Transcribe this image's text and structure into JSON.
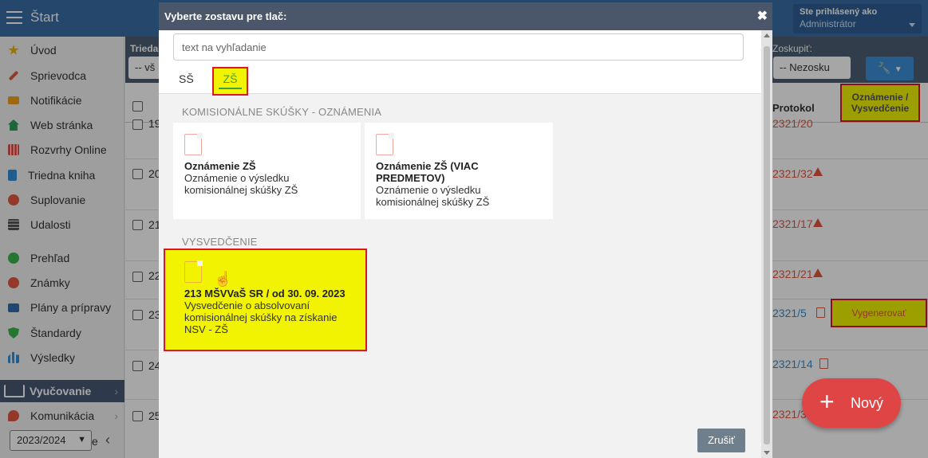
{
  "topbar": {
    "title": "Štart",
    "user_line1": "Ste prihlásený ako",
    "user_line2": "Administrátor"
  },
  "sidebar": {
    "items": [
      {
        "label": "Úvod",
        "icon": "star-icon",
        "color": "#f0b400"
      },
      {
        "label": "Sprievodca",
        "icon": "wand-icon",
        "color": "#e4563f"
      },
      {
        "label": "Notifikácie",
        "icon": "envelope-icon",
        "color": "#f0a020"
      },
      {
        "label": "Web stránka",
        "icon": "home-icon",
        "color": "#2e9e5b"
      },
      {
        "label": "Rozvrhy Online",
        "icon": "grid-icon",
        "color": "#d9534f"
      },
      {
        "label": "Triedna kniha",
        "icon": "book-icon",
        "color": "#2f8fd9"
      },
      {
        "label": "Suplovanie",
        "icon": "person-icon",
        "color": "#e4563f"
      },
      {
        "label": "Udalosti",
        "icon": "calendar-icon",
        "color": "#555555"
      },
      {
        "label": "Prehľad",
        "icon": "check-circle-icon",
        "color": "#3ab54a"
      },
      {
        "label": "Známky",
        "icon": "grade-icon",
        "color": "#e4563f"
      },
      {
        "label": "Plány a prípravy",
        "icon": "briefcase-icon",
        "color": "#2f6fb0"
      },
      {
        "label": "Štandardy",
        "icon": "shield-icon",
        "color": "#3ab54a"
      },
      {
        "label": "Výsledky",
        "icon": "bar-chart-icon",
        "color": "#2f8fd9"
      },
      {
        "label": "Vyučovanie",
        "icon": "open-book-icon",
        "color": "#ffffff"
      },
      {
        "label": "Komunikácia",
        "icon": "chat-icon",
        "color": "#e4563f"
      }
    ],
    "year": "2023/2024",
    "partial_label": "e"
  },
  "filters": {
    "trieda_label": "Trieda",
    "trieda_value": "-- vš",
    "zoskupit_label": "Zoskupiť:",
    "zoskupit_value": "-- Nezosku"
  },
  "table": {
    "col_protokol": "Protokol",
    "col_oznamenie": "Oznámenie / Vysvedčenie",
    "rows": [
      {
        "num": "19",
        "protocol": "2321/20",
        "color": "red"
      },
      {
        "num": "20",
        "protocol": "2321/32",
        "color": "red"
      },
      {
        "num": "21",
        "protocol": "2321/17",
        "color": "red"
      },
      {
        "num": "22",
        "protocol": "2321/21",
        "color": "red"
      },
      {
        "num": "23",
        "protocol": "2321/5",
        "color": "blue"
      },
      {
        "num": "24",
        "protocol": "2321/14",
        "color": "blue"
      },
      {
        "num": "25",
        "protocol": "2321/3",
        "color": "red"
      }
    ],
    "generate_label": "Vygenerovať"
  },
  "new_button": {
    "label": "Nový"
  },
  "modal": {
    "title": "Vyberte zostavu pre tlač:",
    "search_placeholder": "text na vyhľadanie",
    "tabs": [
      "SŠ",
      "ZŠ"
    ],
    "section1": "KOMISIONÁLNE SKÚŠKY - OZNÁMENIA",
    "cards1": [
      {
        "title": "Oznámenie ZŠ",
        "desc": "Oznámenie o výsledku komisionálnej skúšky ZŠ"
      },
      {
        "title": "Oznámenie ZŠ (VIAC PREDMETOV)",
        "desc": "Oznámenie o výsledku komisionálnej skúšky ZŠ"
      }
    ],
    "section2": "VYSVEDČENIE",
    "cards2": [
      {
        "title": "213 MŠVVaŠ SR / od 30. 09. 2023",
        "desc": "Vysvedčenie o absolvovaní komisionálnej skúšky na získanie NSV - ZŠ"
      }
    ],
    "cancel": "Zrušiť",
    "highlight_color": "#f1f300"
  }
}
